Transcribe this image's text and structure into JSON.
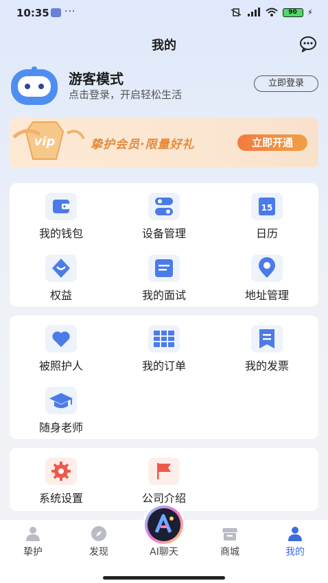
{
  "status_bar": {
    "time": "10:35",
    "dots": "···",
    "battery": "90"
  },
  "header": {
    "title": "我的"
  },
  "profile": {
    "name": "游客模式",
    "subtitle": "点击登录，开启轻松生活",
    "login_label": "立即登录"
  },
  "vip": {
    "badge": "vip",
    "text": "挚护会员·限量好礼",
    "button": "立即开通"
  },
  "section1": {
    "items": [
      {
        "label": "我的钱包",
        "icon": "wallet-icon"
      },
      {
        "label": "设备管理",
        "icon": "device-icon"
      },
      {
        "label": "日历",
        "icon": "calendar-icon",
        "icon_text": "15"
      },
      {
        "label": "权益",
        "icon": "benefits-icon"
      },
      {
        "label": "我的面试",
        "icon": "interview-icon"
      },
      {
        "label": "地址管理",
        "icon": "location-icon"
      }
    ]
  },
  "section2": {
    "items": [
      {
        "label": "被照护人",
        "icon": "heart-icon"
      },
      {
        "label": "我的订单",
        "icon": "order-icon"
      },
      {
        "label": "我的发票",
        "icon": "invoice-icon"
      },
      {
        "label": "随身老师",
        "icon": "teacher-icon"
      }
    ]
  },
  "section3": {
    "items": [
      {
        "label": "系统设置",
        "icon": "gear-icon"
      },
      {
        "label": "公司介绍",
        "icon": "flag-icon"
      }
    ]
  },
  "nav": {
    "items": [
      {
        "label": "挚护",
        "icon": "person-icon"
      },
      {
        "label": "发现",
        "icon": "compass-icon"
      },
      {
        "label": "AI聊天",
        "icon": "ai-chat-icon"
      },
      {
        "label": "商城",
        "icon": "store-icon"
      },
      {
        "label": "我的",
        "icon": "profile-icon",
        "active": true
      }
    ]
  },
  "colors": {
    "accent": "#3b6de0",
    "icon_blue": "#4a7be8",
    "icon_red": "#ec5a4c",
    "vip_orange": "#f27b3e"
  }
}
